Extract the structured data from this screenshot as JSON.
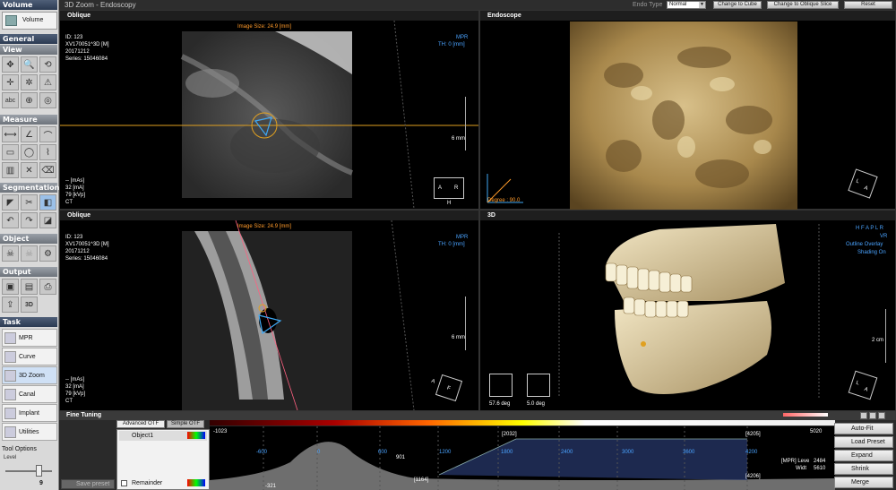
{
  "left_panel": {
    "volume_header": "Volume",
    "volume_button": "Volume",
    "general_header": "General",
    "view_header": "View",
    "measure_header": "Measure",
    "segmentation_header": "Segmentation",
    "object_header": "Object",
    "output_header": "Output",
    "task_header": "Task",
    "tasks": [
      "MPR",
      "Curve",
      "3D Zoom",
      "Canal",
      "Implant",
      "Utilities"
    ],
    "tool_options": "Tool Options",
    "level_label": "Level",
    "level_value": "9"
  },
  "titlebar": {
    "title": "3D Zoom - Endoscopy",
    "endo_type_label": "Endo Type",
    "endo_type_value": "Normal",
    "btn_cube": "Change to Cube",
    "btn_oblique": "Change to Oblique Slice",
    "btn_reset": "Reset"
  },
  "vp_top_left": {
    "title": "Oblique",
    "image_size": "Image Size: 24.9 [mm]",
    "id": "ID: 123",
    "patient": "XV170051^3D [M]",
    "date": "20171212",
    "series": "Series: 15046084",
    "mode": "MPR",
    "th": "TH: 0 [mm]",
    "scale": "6 mm",
    "mas": "-- [mAs]",
    "ma": "32 [mA]",
    "kvp": "79 [kVp]",
    "ct": "CT",
    "orient_a": "A",
    "orient_r": "R",
    "orient_h": "H"
  },
  "vp_top_right": {
    "title": "Endoscope",
    "degree": "Degree : 90.0",
    "cube_l": "L",
    "cube_a": "A"
  },
  "vp_bot_left": {
    "title": "Oblique",
    "image_size": "Image Size: 24.9 [mm]",
    "id": "ID: 123",
    "patient": "XV170051^3D [M]",
    "date": "20171212",
    "series": "Series: 15046084",
    "mode": "MPR",
    "th": "TH: 0 [mm]",
    "scale": "6 mm",
    "mas": "-- [mAs]",
    "ma": "32 [mA]",
    "kvp": "79 [kVp]",
    "ct": "CT",
    "orient_a": "A",
    "orient_f": "F"
  },
  "vp_bot_right": {
    "title": "3D",
    "hfaplr": "H F A P L R",
    "vr": "VR",
    "outline": "Outline Overlay",
    "shading": "Shading On",
    "scale": "2 cm",
    "deg1": "57.6 deg",
    "deg2": "5.0 deg",
    "cube_l": "L",
    "cube_a": "A"
  },
  "fine_tuning": {
    "title": "Fine Tuning",
    "tab_advanced": "Advanced OTF",
    "tab_simple": "Simple OTF",
    "object1": "Object1",
    "remainder": "Remainder",
    "save_preset": "Save preset",
    "min": "-1023",
    "max": "5020",
    "pk1": "[2032]",
    "pk2": "[4205]",
    "pk3": "[1164]",
    "pk4": "[4206]",
    "v901": "901",
    "v321": "-321",
    "ticks": [
      "-600",
      "0",
      "600",
      "1200",
      "1800",
      "2400",
      "3000",
      "3600",
      "4200"
    ],
    "mpr_level": "[MPR] Leve",
    "mpr_level_val": "2484",
    "width": "Widt",
    "width_val": "5610"
  },
  "right_buttons": [
    "Auto-Fit",
    "Load Preset",
    "Expand",
    "Shrink",
    "Merge"
  ]
}
